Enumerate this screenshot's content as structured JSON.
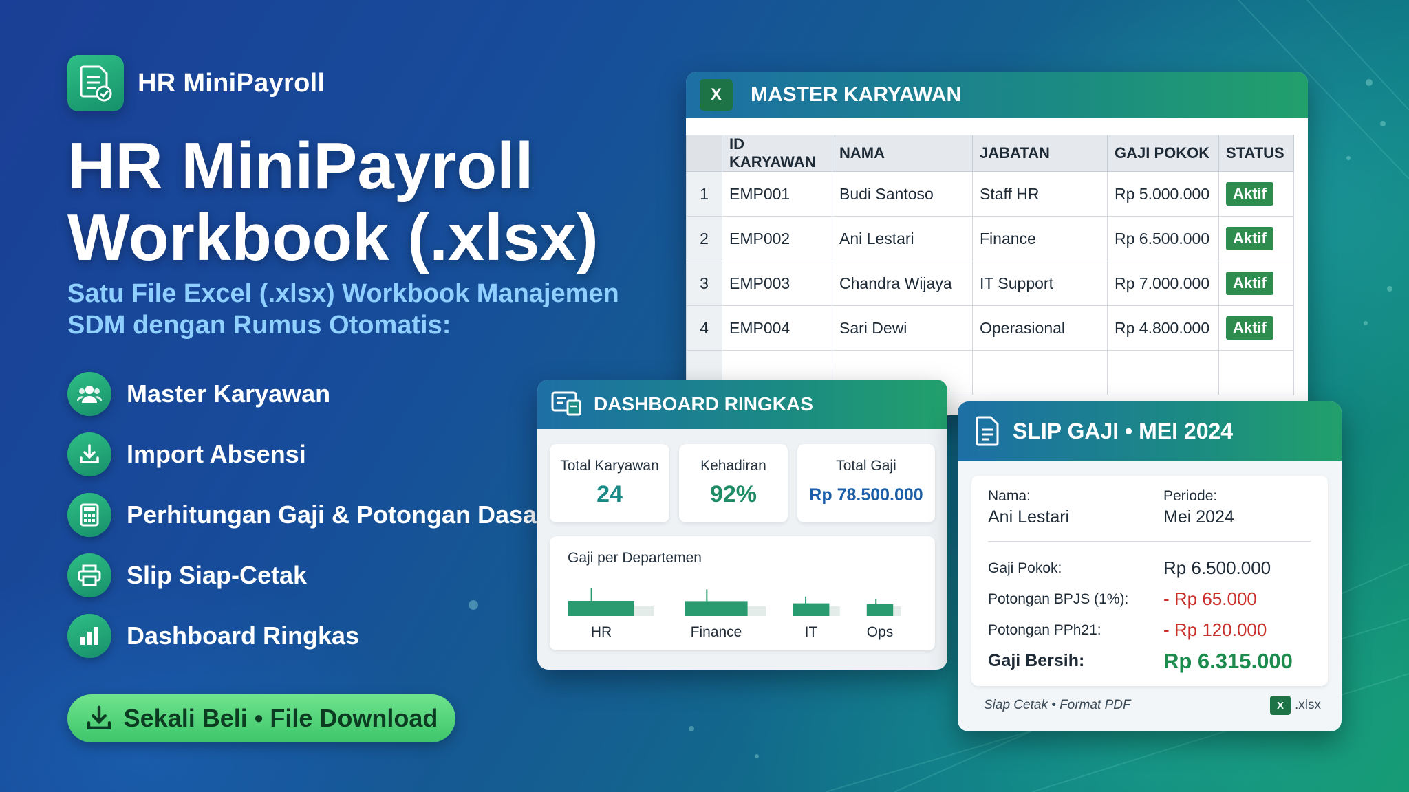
{
  "brand": {
    "name": "HR MiniPayroll"
  },
  "hero": {
    "title_line1": "HR MiniPayroll",
    "title_line2": "Workbook (.xlsx)",
    "subtitle_line1": "Satu File Excel (.xlsx) Workbook Manajemen",
    "subtitle_line2": "SDM dengan Rumus Otomatis:"
  },
  "features": [
    {
      "label": "Master Karyawan",
      "icon": "users-icon"
    },
    {
      "label": "Import Absensi",
      "icon": "download-icon"
    },
    {
      "label": "Perhitungan Gaji & Potongan Dasar",
      "icon": "calculator-icon"
    },
    {
      "label": "Slip Siap-Cetak",
      "icon": "printer-icon"
    },
    {
      "label": "Dashboard Ringkas",
      "icon": "bar-chart-icon"
    }
  ],
  "cta": {
    "label": "Sekali Beli • File Download"
  },
  "master": {
    "title": "MASTER KARYAWAN",
    "columns": [
      "ID KARYAWAN",
      "NAMA",
      "JABATAN",
      "GAJI POKOK",
      "STATUS"
    ],
    "rows": [
      {
        "n": "1",
        "id": "EMP001",
        "nama": "Budi Santoso",
        "jabatan": "Staff HR",
        "gaji": "Rp 5.000.000",
        "status": "Aktif"
      },
      {
        "n": "2",
        "id": "EMP002",
        "nama": "Ani Lestari",
        "jabatan": "Finance",
        "gaji": "Rp 6.500.000",
        "status": "Aktif"
      },
      {
        "n": "3",
        "id": "EMP003",
        "nama": "Chandra Wijaya",
        "jabatan": "IT Support",
        "gaji": "Rp 7.000.000",
        "status": "Aktif"
      },
      {
        "n": "4",
        "id": "EMP004",
        "nama": "Sari Dewi",
        "jabatan": "Operasional",
        "gaji": "Rp 4.800.000",
        "status": "Aktif"
      }
    ]
  },
  "dashboard": {
    "title": "DASHBOARD RINGKAS",
    "kpis": [
      {
        "label": "Total Karyawan",
        "value": "24"
      },
      {
        "label": "Kehadiran",
        "value": "92%"
      },
      {
        "label": "Total Gaji",
        "value": "Rp 78.500.000"
      }
    ],
    "chart_title": "Gaji per Departemen"
  },
  "chart_data": {
    "type": "bar",
    "title": "Gaji per Departemen",
    "categories": [
      "HR",
      "Finance",
      "IT",
      "Ops"
    ],
    "values": [
      1.0,
      0.95,
      0.55,
      0.4
    ],
    "xlabel": "",
    "ylabel": "",
    "grid": false
  },
  "slip": {
    "title": "SLIP GAJI • MEI 2024",
    "nama_label": "Nama:",
    "nama_value": "Ani Lestari",
    "periode_label": "Periode:",
    "periode_value": "Mei 2024",
    "items": [
      {
        "label": "Gaji Pokok:",
        "value": "Rp 6.500.000",
        "kind": "pos"
      },
      {
        "label": "Potongan BPJS (1%):",
        "value": "- Rp 65.000",
        "kind": "neg"
      },
      {
        "label": "Potongan PPh21:",
        "value": "- Rp 120.000",
        "kind": "neg"
      }
    ],
    "total_label": "Gaji Bersih:",
    "total_value": "Rp 6.315.000",
    "footer_left": "Siap Cetak • Format PDF",
    "footer_right": ".xlsx"
  },
  "colors": {
    "accent_green": "#2fbf86",
    "cta_green": "#5bd67f",
    "excel_green": "#1d7346",
    "negative_red": "#c9302c",
    "subtitle_blue": "#8fd0ff"
  }
}
